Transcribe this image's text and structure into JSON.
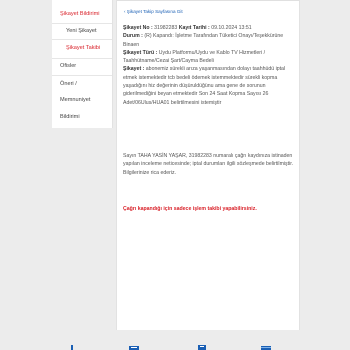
{
  "sidebar": {
    "items": [
      {
        "label": "Şikayet Bildirimi"
      },
      {
        "label": "Yeni Şikayet"
      },
      {
        "label": "Şikayet Takibi"
      },
      {
        "label": "Ofisler"
      },
      {
        "label": "Öneri /"
      },
      {
        "label": "Memnuniyet"
      },
      {
        "label": "Bildirimi"
      }
    ]
  },
  "main": {
    "back_link": "‹ Şikayet Takip Sayfasına Git",
    "complaint": {
      "no_label": "Şikayet No :",
      "no_value": "31982283",
      "date_label": "Kayıt Tarihi :",
      "date_value": "09.10.2024 13:51",
      "status_label": "Durum :",
      "status_value": "(R) Kapandı: İşletme Tarafından Tüketici Onayı/Teşekkürüne Binaen",
      "type_label": "Şikayet Türü :",
      "type_value": "Uydu Platformu/Uydu ve Kablo TV Hizmetleri / Taahhütname/Cezai Şart/Cayma Bedeli",
      "body_label": "Şikayet :",
      "body_value": "abonemiz sürekli arıza yaşanmasından dolayı taahhüdü iptal etmek istemektedir tcb bedeli ödemek istemmektedir sürekli kopma yaşadığını hiz değerinin düşüruldüğünu ama gene de sorunun giderilmediğini beyan etmektedir Son 24 Saat Kopma Sayısı 26 Adet/06Ulus/HUA01 belirtilmesini istemiştir"
    },
    "response": "Sayın TAHA YASİN YAŞAR, 31982283 numaralı çağrı kaydınıza istinaden yapılan inceleme neticesinde; iptal durumları ilgili sözleşmede belirtilmiştir. Bilgilerinize rica ederiz.",
    "closed_notice": "Çağrı kapandığı için sadece işlem takibi yapabilirsiniz."
  },
  "bottom_nav": {
    "icons": [
      "person-icon",
      "list-icon",
      "document-icon",
      "card-icon"
    ]
  }
}
